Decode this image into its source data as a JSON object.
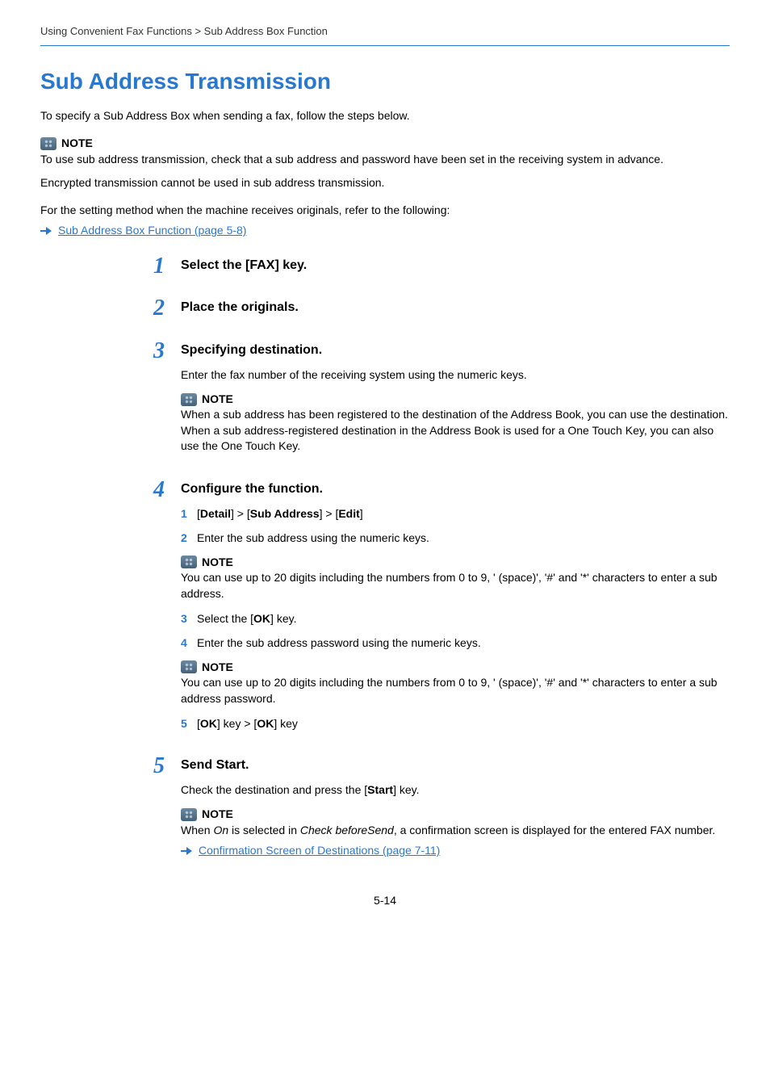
{
  "breadcrumb": "Using Convenient Fax Functions > Sub Address Box Function",
  "title": "Sub Address Transmission",
  "intro": "To specify a Sub Address Box when sending a fax, follow the steps below.",
  "note1": {
    "label": "NOTE",
    "line1": "To use sub address transmission, check that a sub address and password have been set in the receiving system in advance.",
    "line2": "Encrypted transmission cannot be used in sub address transmission."
  },
  "setting_ref": "For the setting method when the machine receives originals, refer to the following:",
  "link1": "Sub Address Box Function (page 5-8)",
  "steps": {
    "s1": {
      "num": "1",
      "title": "Select the [FAX] key."
    },
    "s2": {
      "num": "2",
      "title": "Place the originals."
    },
    "s3": {
      "num": "3",
      "title": "Specifying destination.",
      "text": "Enter the fax number of the receiving system using the numeric keys.",
      "note": {
        "label": "NOTE",
        "text": "When a sub address has been registered to the destination of the Address Book, you can use the destination. When a sub address-registered destination in the Address Book is used for a One Touch Key, you can also use the One Touch Key."
      }
    },
    "s4": {
      "num": "4",
      "title": "Configure the function.",
      "sub1": {
        "num": "1",
        "detail": "Detail",
        "sub_address": "Sub Address",
        "edit": "Edit"
      },
      "sub2": {
        "num": "2",
        "text": "Enter the sub address using the numeric keys."
      },
      "note_a": {
        "label": "NOTE",
        "text": "You can use up to 20 digits including the numbers from 0 to 9, ' (space)', '#' and '*' characters to enter a sub address."
      },
      "sub3": {
        "num": "3",
        "prefix": "Select the [",
        "ok": "OK",
        "suffix": "] key."
      },
      "sub4": {
        "num": "4",
        "text": "Enter the sub address password using the numeric keys."
      },
      "note_b": {
        "label": "NOTE",
        "text": "You can use up to 20 digits including the numbers from 0 to 9, ' (space)', '#' and '*' characters to enter a sub address password."
      },
      "sub5": {
        "num": "5",
        "ok1": "OK",
        "mid": "] key > [",
        "ok2": "OK",
        "suffix": "] key"
      }
    },
    "s5": {
      "num": "5",
      "title": "Send Start.",
      "text_prefix": "Check the destination and press the [",
      "start": "Start",
      "text_suffix": "] key.",
      "note": {
        "label": "NOTE",
        "prefix": "When ",
        "on": "On",
        "mid": " is selected in ",
        "cbs": "Check beforeSend",
        "suffix": ", a confirmation screen is displayed for the entered FAX number."
      },
      "link": "Confirmation Screen of Destinations (page 7-11)"
    }
  },
  "page_num": "5-14"
}
